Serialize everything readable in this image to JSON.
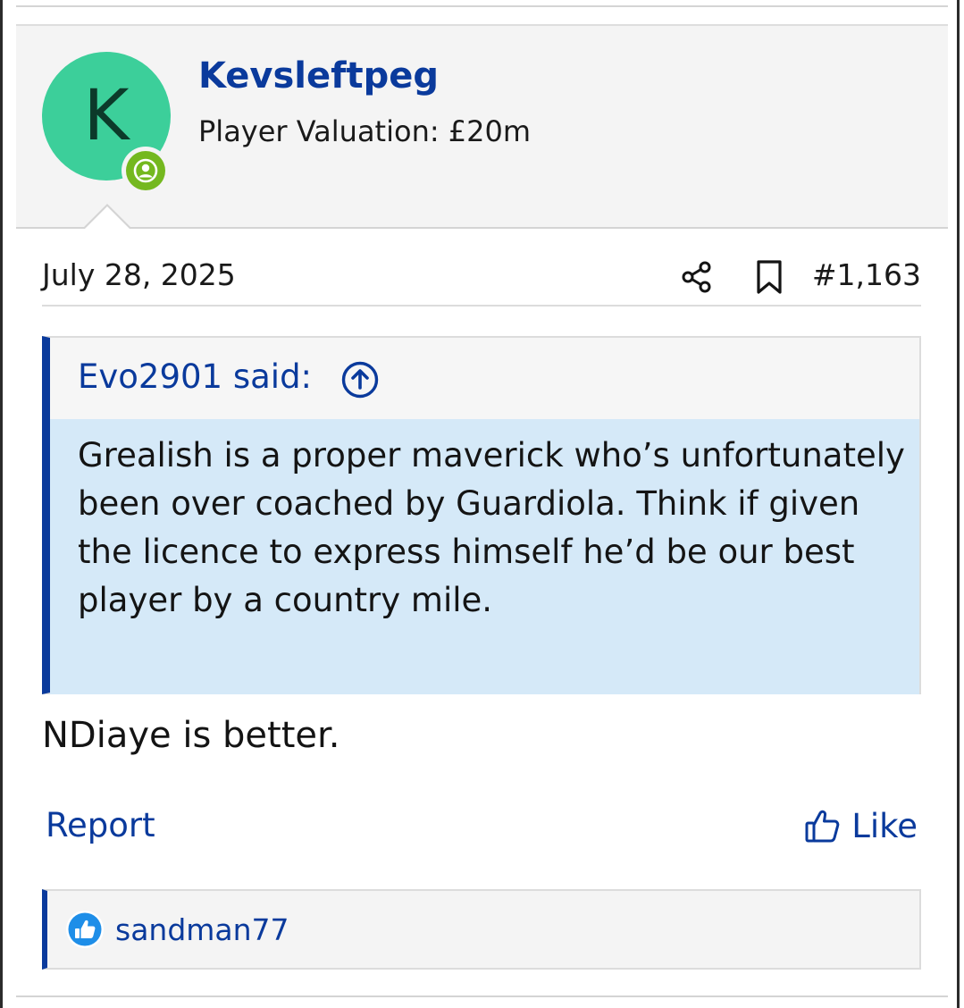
{
  "user": {
    "avatar_letter": "K",
    "username": "Kevsleftpeg",
    "valuation": "Player Valuation: £20m"
  },
  "post": {
    "date": "July 28, 2025",
    "number": "#1,163",
    "message": "NDiaye is better."
  },
  "quote": {
    "author": "Evo2901 said:",
    "text": "Grealish is a proper maverick who’s unfortunately been over coached by Guardiola. Think if given the licence to express himself he’d be our best player by a country mile."
  },
  "actions": {
    "report_label": "Report",
    "like_label": "Like"
  },
  "reactions": {
    "users": "sandman77"
  },
  "colors": {
    "brand": "#0a3a9c",
    "avatar_bg": "#3ccf9a",
    "online": "#74b81f",
    "quote_body_bg": "#d5e9f8",
    "reaction_blue": "#1e8ee8"
  },
  "icons": {
    "share": "share-icon",
    "bookmark": "bookmark-icon",
    "quote_jump": "arrow-up-circle-icon",
    "like": "thumbs-up-icon",
    "online": "user-online-icon",
    "reaction": "like-reaction-icon"
  }
}
